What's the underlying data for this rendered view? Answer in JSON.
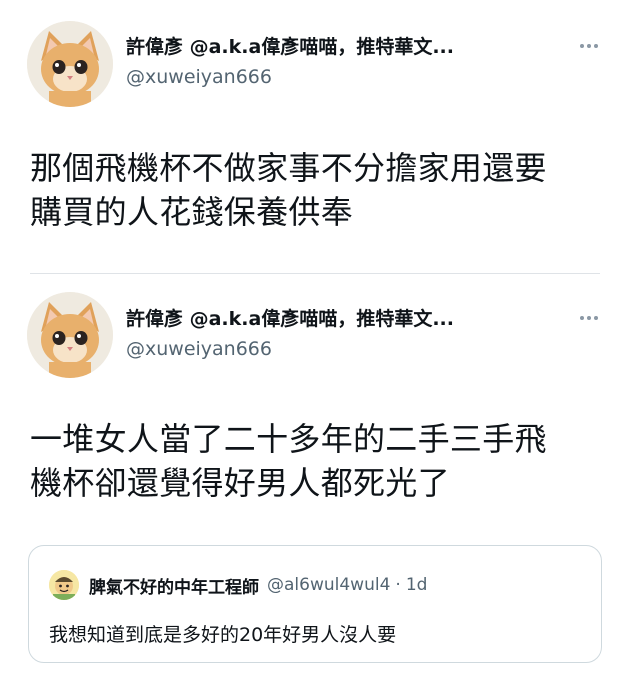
{
  "tweets": [
    {
      "display_name": "許偉彥 @a.k.a偉彥喵喵，推特華文...",
      "handle": "@xuweiyan666",
      "text_lines": [
        "那個飛機杯不做家事不分擔家用還要",
        "購買的人花錢保養供奉"
      ]
    },
    {
      "display_name": "許偉彥 @a.k.a偉彥喵喵，推特華文...",
      "handle": "@xuweiyan666",
      "text_lines": [
        "一堆女人當了二十多年的二手三手飛",
        "機杯卻還覺得好男人都死光了"
      ]
    }
  ],
  "quoted_tweet": {
    "display_name": "脾氣不好的中年工程師",
    "handle": "@al6wul4wul4",
    "separator": "·",
    "time": "1d",
    "text": "我想知道到底是多好的20年好男人沒人要"
  },
  "icons": {
    "avatar": "kitten-avatar",
    "quoted_avatar": "cartoon-face-avatar",
    "more": "more-options-icon"
  },
  "colors": {
    "text": "#0f1419",
    "secondary": "#536471",
    "border": "#cfd9de"
  }
}
